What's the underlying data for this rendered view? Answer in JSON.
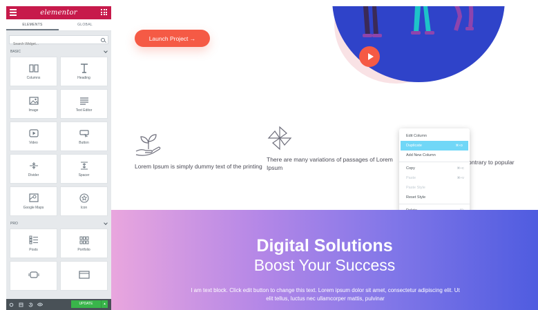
{
  "sidebar": {
    "logo": "elementor",
    "tabs": [
      {
        "label": "ELEMENTS",
        "active": true
      },
      {
        "label": "GLOBAL",
        "active": false
      }
    ],
    "search_placeholder": "Search Widget...",
    "sections": {
      "basic": "BASIC",
      "pro": "PRO"
    },
    "basic_widgets": [
      {
        "label": "Columns",
        "icon": "columns-icon"
      },
      {
        "label": "Heading",
        "icon": "heading-icon"
      },
      {
        "label": "Image",
        "icon": "image-icon"
      },
      {
        "label": "Text Editor",
        "icon": "text-editor-icon"
      },
      {
        "label": "Video",
        "icon": "video-icon"
      },
      {
        "label": "Button",
        "icon": "button-icon"
      },
      {
        "label": "Divider",
        "icon": "divider-icon"
      },
      {
        "label": "Spacer",
        "icon": "spacer-icon"
      },
      {
        "label": "Google Maps",
        "icon": "map-icon"
      },
      {
        "label": "Icon",
        "icon": "star-icon"
      }
    ],
    "pro_widgets": [
      {
        "label": "Posts",
        "icon": "posts-icon"
      },
      {
        "label": "Portfolio",
        "icon": "portfolio-icon"
      },
      {
        "label": "",
        "icon": "slides-icon"
      },
      {
        "label": "",
        "icon": "form-icon"
      }
    ],
    "bottom": {
      "update_label": "UPDATE"
    }
  },
  "canvas": {
    "launch_button": "Launch Project  →",
    "features": [
      {
        "text": "Lorem Ipsum is simply dummy text of the printing",
        "icon": "plant-hand-icon"
      },
      {
        "text": "There are many variations of passages of Lorem Ipsum",
        "icon": "pinwheel-icon"
      },
      {
        "text": "ontrary to popular",
        "icon": "feature-icon"
      }
    ],
    "band": {
      "title": "Digital Solutions",
      "subtitle": "Boost Your Success",
      "text": "I am text block. Click edit button to change this text. Lorem ipsum dolor sit amet, consectetur adipiscing elit. Ut elit tellus, luctus nec ullamcorper mattis, pulvinar"
    }
  },
  "context_menu": {
    "items": [
      {
        "label": "Edit Column",
        "shortcut": "",
        "state": "normal"
      },
      {
        "label": "Duplicate",
        "shortcut": "⌘+D",
        "state": "highlighted"
      },
      {
        "label": "Add New Column",
        "shortcut": "",
        "state": "normal"
      },
      {
        "label": "Copy",
        "shortcut": "⌘+C",
        "state": "normal"
      },
      {
        "label": "Paste",
        "shortcut": "⌘+V",
        "state": "disabled"
      },
      {
        "label": "Paste Style",
        "shortcut": "",
        "state": "disabled"
      },
      {
        "label": "Reset Style",
        "shortcut": "",
        "state": "normal"
      },
      {
        "label": "Delete",
        "shortcut": "⌦",
        "state": "normal"
      }
    ]
  },
  "colors": {
    "brand": "#c71a4b",
    "accent": "#f55a45",
    "hero_blue": "#2f43c9",
    "update_green": "#39b54a",
    "menu_highlight": "#71d7f7"
  }
}
